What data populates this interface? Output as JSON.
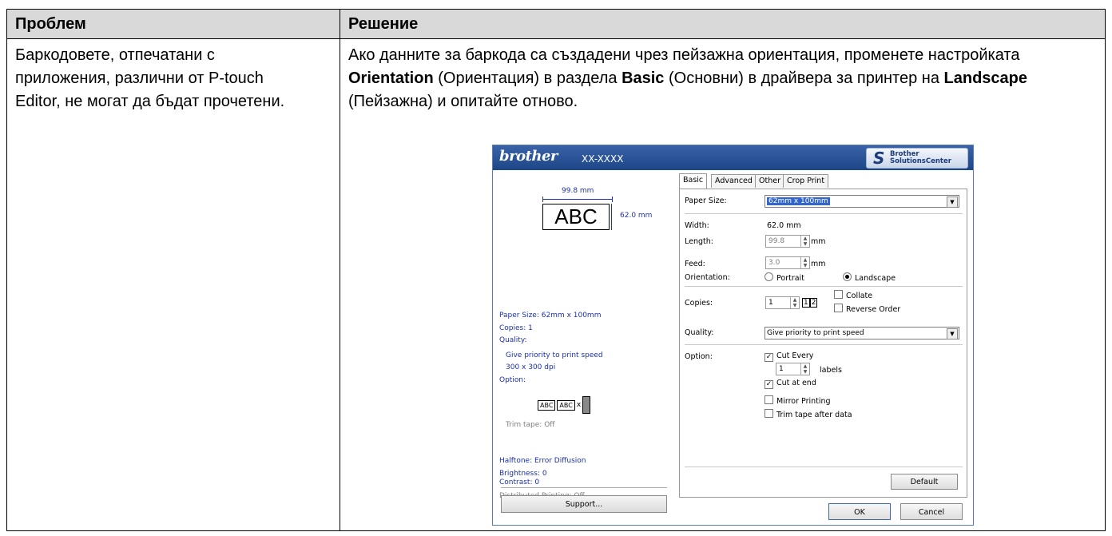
{
  "table": {
    "header_problem": "Проблем",
    "header_solution": "Решение",
    "problem_text": "Баркодовете, отпечатани с приложения, различни от P-touch Editor, не могат да бъдат прочетени.",
    "solution": {
      "part1": "Ако данните за баркода са създадени чрез пейзажна ориентация, променете настройката ",
      "bold1": "Orientation",
      "part2": " (Ориентация) в раздела ",
      "bold2": "Basic",
      "part3": " (Основни) в драйвера за принтер на ",
      "bold3": "Landscape",
      "part4": " (Пейзажна) и опитайте отново."
    }
  },
  "dialog": {
    "brand": "brother",
    "model": "XX-XXXX",
    "solutions_center_line1": "Brother",
    "solutions_center_line2": "SolutionsCenter",
    "preview": {
      "width_label": "99.8 mm",
      "height_label": "62.0 mm",
      "sample_text": "ABC",
      "paper_size": "Paper Size: 62mm x 100mm",
      "copies": "Copies: 1",
      "quality_label": "Quality:",
      "quality_value": "Give priority to print speed",
      "resolution": "300 x 300 dpi",
      "option_label": "Option:",
      "mini_label_1": "ABC",
      "mini_label_2": "ABC",
      "mini_cut": "x",
      "trim_tape": "Trim tape: Off",
      "halftone": "Halftone: Error Diffusion",
      "brightness": "Brightness:  0",
      "contrast": "Contrast:  0",
      "distributed": "Distributed Printing: Off",
      "support_button": "Support..."
    },
    "tabs": [
      "Basic",
      "Advanced",
      "Other",
      "Crop Print"
    ],
    "basic": {
      "paper_size_label": "Paper Size:",
      "paper_size_value": "62mm x 100mm",
      "width_label": "Width:",
      "width_value": "62.0 mm",
      "length_label": "Length:",
      "length_value": "99.8",
      "feed_label": "Feed:",
      "feed_value": "3.0",
      "unit": "mm",
      "orientation_label": "Orientation:",
      "portrait": "Portrait",
      "landscape": "Landscape",
      "copies_label": "Copies:",
      "copies_value": "1",
      "collate": "Collate",
      "reverse_order": "Reverse Order",
      "quality_label": "Quality:",
      "quality_value": "Give priority to print speed",
      "option_label": "Option:",
      "cut_every": "Cut Every",
      "cut_every_value": "1",
      "labels": "labels",
      "cut_at_end": "Cut at end",
      "mirror_printing": "Mirror Printing",
      "trim_tape_after_data": "Trim tape after data",
      "default_button": "Default"
    },
    "ok_button": "OK",
    "cancel_button": "Cancel"
  }
}
